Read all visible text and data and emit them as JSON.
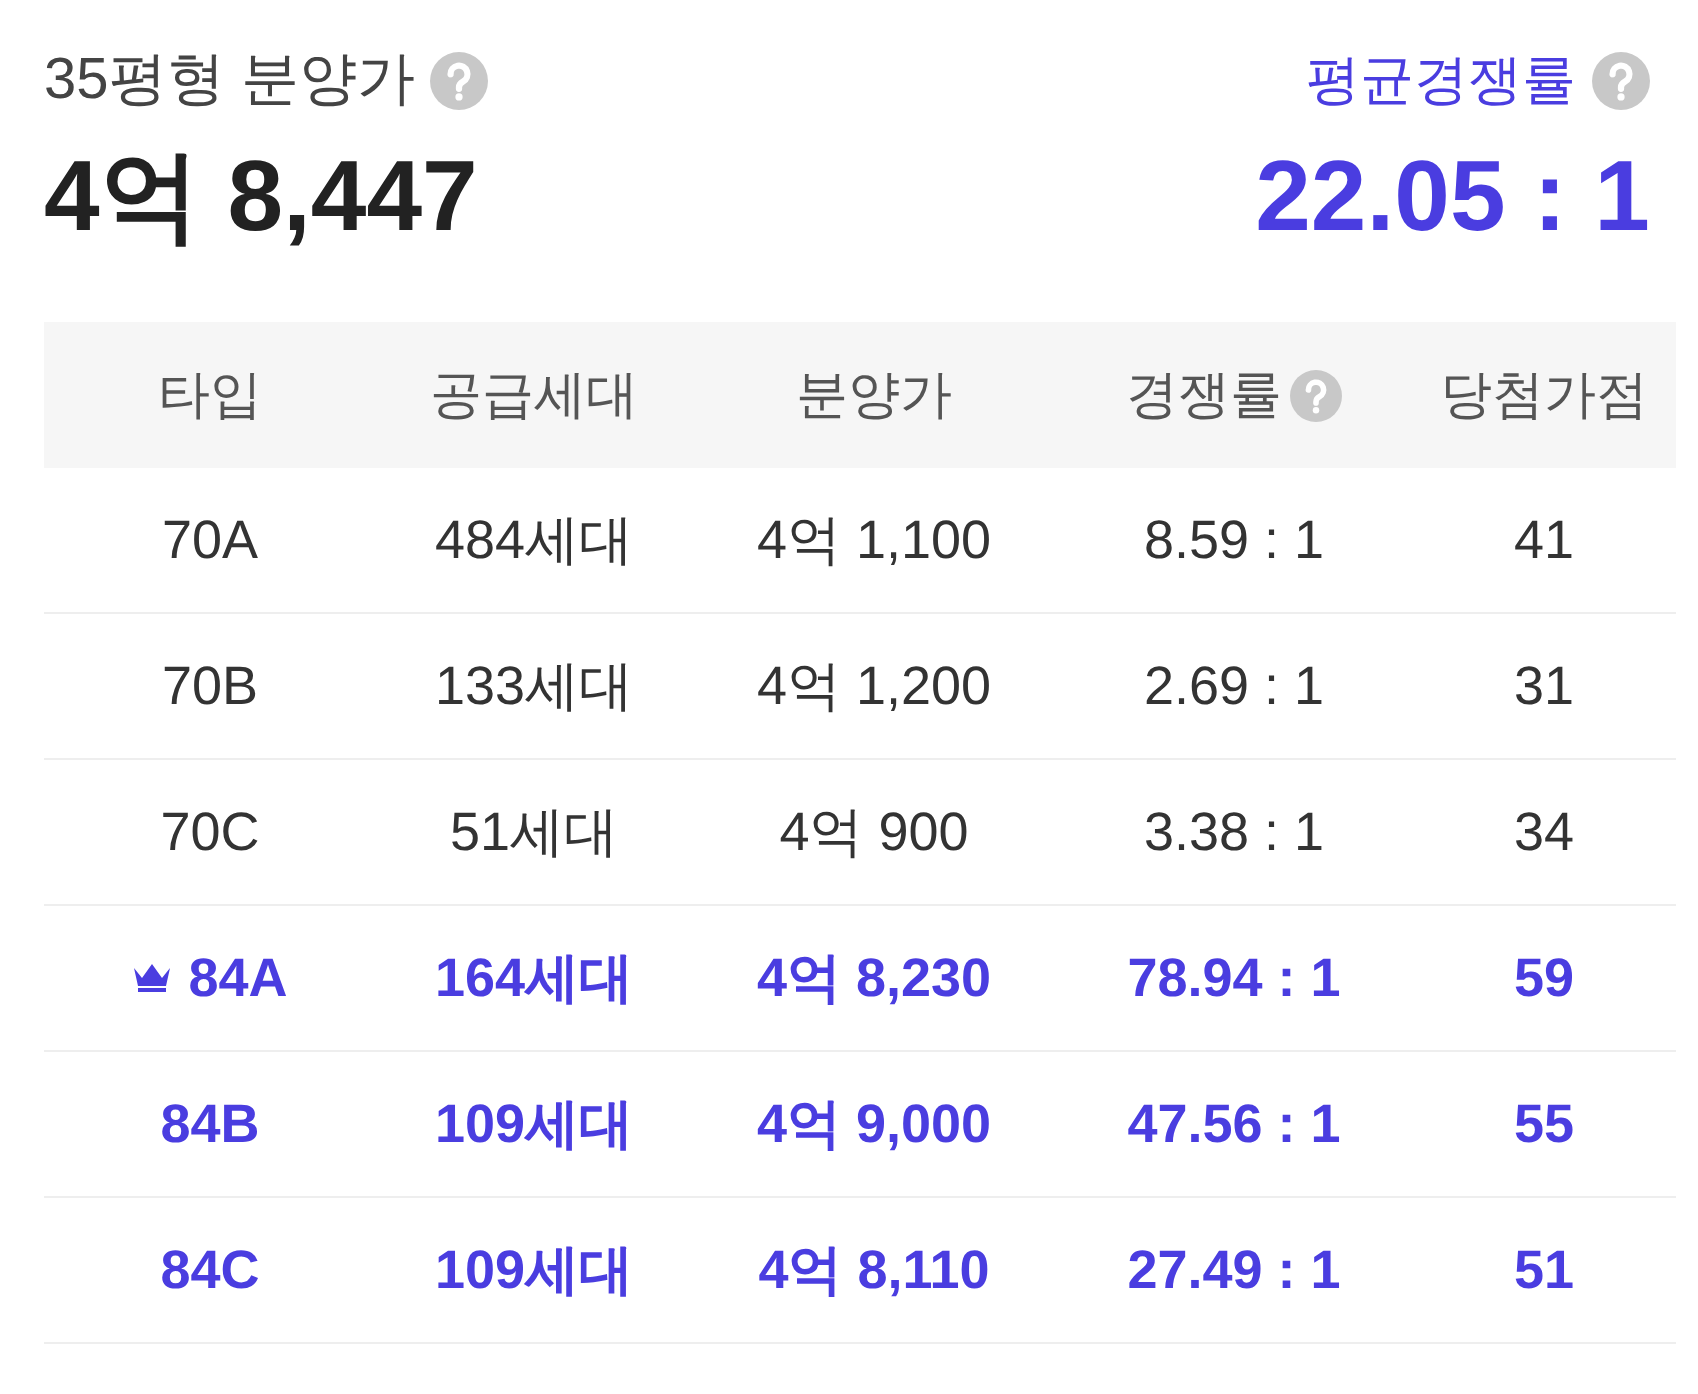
{
  "summary": {
    "label": "35평형 분양가",
    "price": "4억 8,447",
    "avg_label": "평균경쟁률",
    "avg_rate": "22.05 : 1"
  },
  "table": {
    "columns": [
      {
        "label": "타입",
        "help": false
      },
      {
        "label": "공급세대",
        "help": false
      },
      {
        "label": "분양가",
        "help": false
      },
      {
        "label": "경쟁률",
        "help": true
      },
      {
        "label": "당첨가점",
        "help": false
      }
    ],
    "rows": [
      {
        "highlighted": false,
        "crown": false,
        "cells": [
          "70A",
          "484세대",
          "4억 1,100",
          "8.59 : 1",
          "41"
        ]
      },
      {
        "highlighted": false,
        "crown": false,
        "cells": [
          "70B",
          "133세대",
          "4억 1,200",
          "2.69 : 1",
          "31"
        ]
      },
      {
        "highlighted": false,
        "crown": false,
        "cells": [
          "70C",
          "51세대",
          "4억 900",
          "3.38 : 1",
          "34"
        ]
      },
      {
        "highlighted": true,
        "crown": true,
        "cells": [
          "84A",
          "164세대",
          "4억 8,230",
          "78.94 : 1",
          "59"
        ]
      },
      {
        "highlighted": true,
        "crown": false,
        "cells": [
          "84B",
          "109세대",
          "4억 9,000",
          "47.56 : 1",
          "55"
        ]
      },
      {
        "highlighted": true,
        "crown": false,
        "cells": [
          "84C",
          "109세대",
          "4억 8,110",
          "27.49 : 1",
          "51"
        ]
      }
    ]
  }
}
